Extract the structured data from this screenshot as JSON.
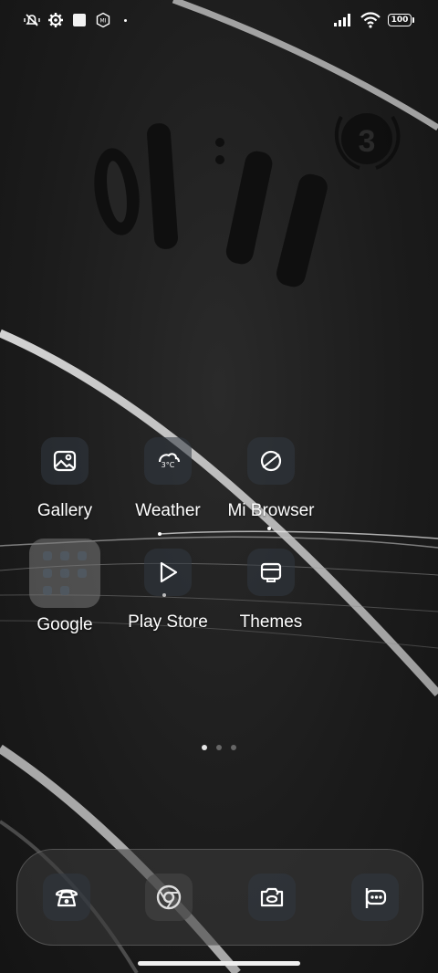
{
  "status_bar": {
    "left_icons": [
      "mute-vibrate-icon",
      "settings-gear-icon",
      "white-square-icon",
      "mi-icon"
    ],
    "right_icons": [
      "signal-icon",
      "wifi-icon"
    ],
    "battery_level": "100"
  },
  "wallpaper": {
    "clock_text": "01:11",
    "badge_text": "3"
  },
  "apps": [
    {
      "label": "Gallery",
      "icon": "gallery-icon"
    },
    {
      "label": "Weather",
      "icon": "weather-icon",
      "icon_text": "3°C"
    },
    {
      "label": "Mi Browser",
      "icon": "browser-icon"
    },
    {
      "label": "Google",
      "icon": "folder-icon"
    },
    {
      "label": "Play Store",
      "icon": "play-store-icon"
    },
    {
      "label": "Themes",
      "icon": "themes-icon"
    }
  ],
  "pager": {
    "pages": 3,
    "active": 0
  },
  "dock": [
    {
      "name": "phone",
      "icon": "phone-icon"
    },
    {
      "name": "chrome",
      "icon": "chrome-icon"
    },
    {
      "name": "camera",
      "icon": "camera-icon"
    },
    {
      "name": "messages",
      "icon": "messages-icon"
    }
  ],
  "colors": {
    "accent": "#ffffff",
    "background": "#1b1b1b"
  }
}
